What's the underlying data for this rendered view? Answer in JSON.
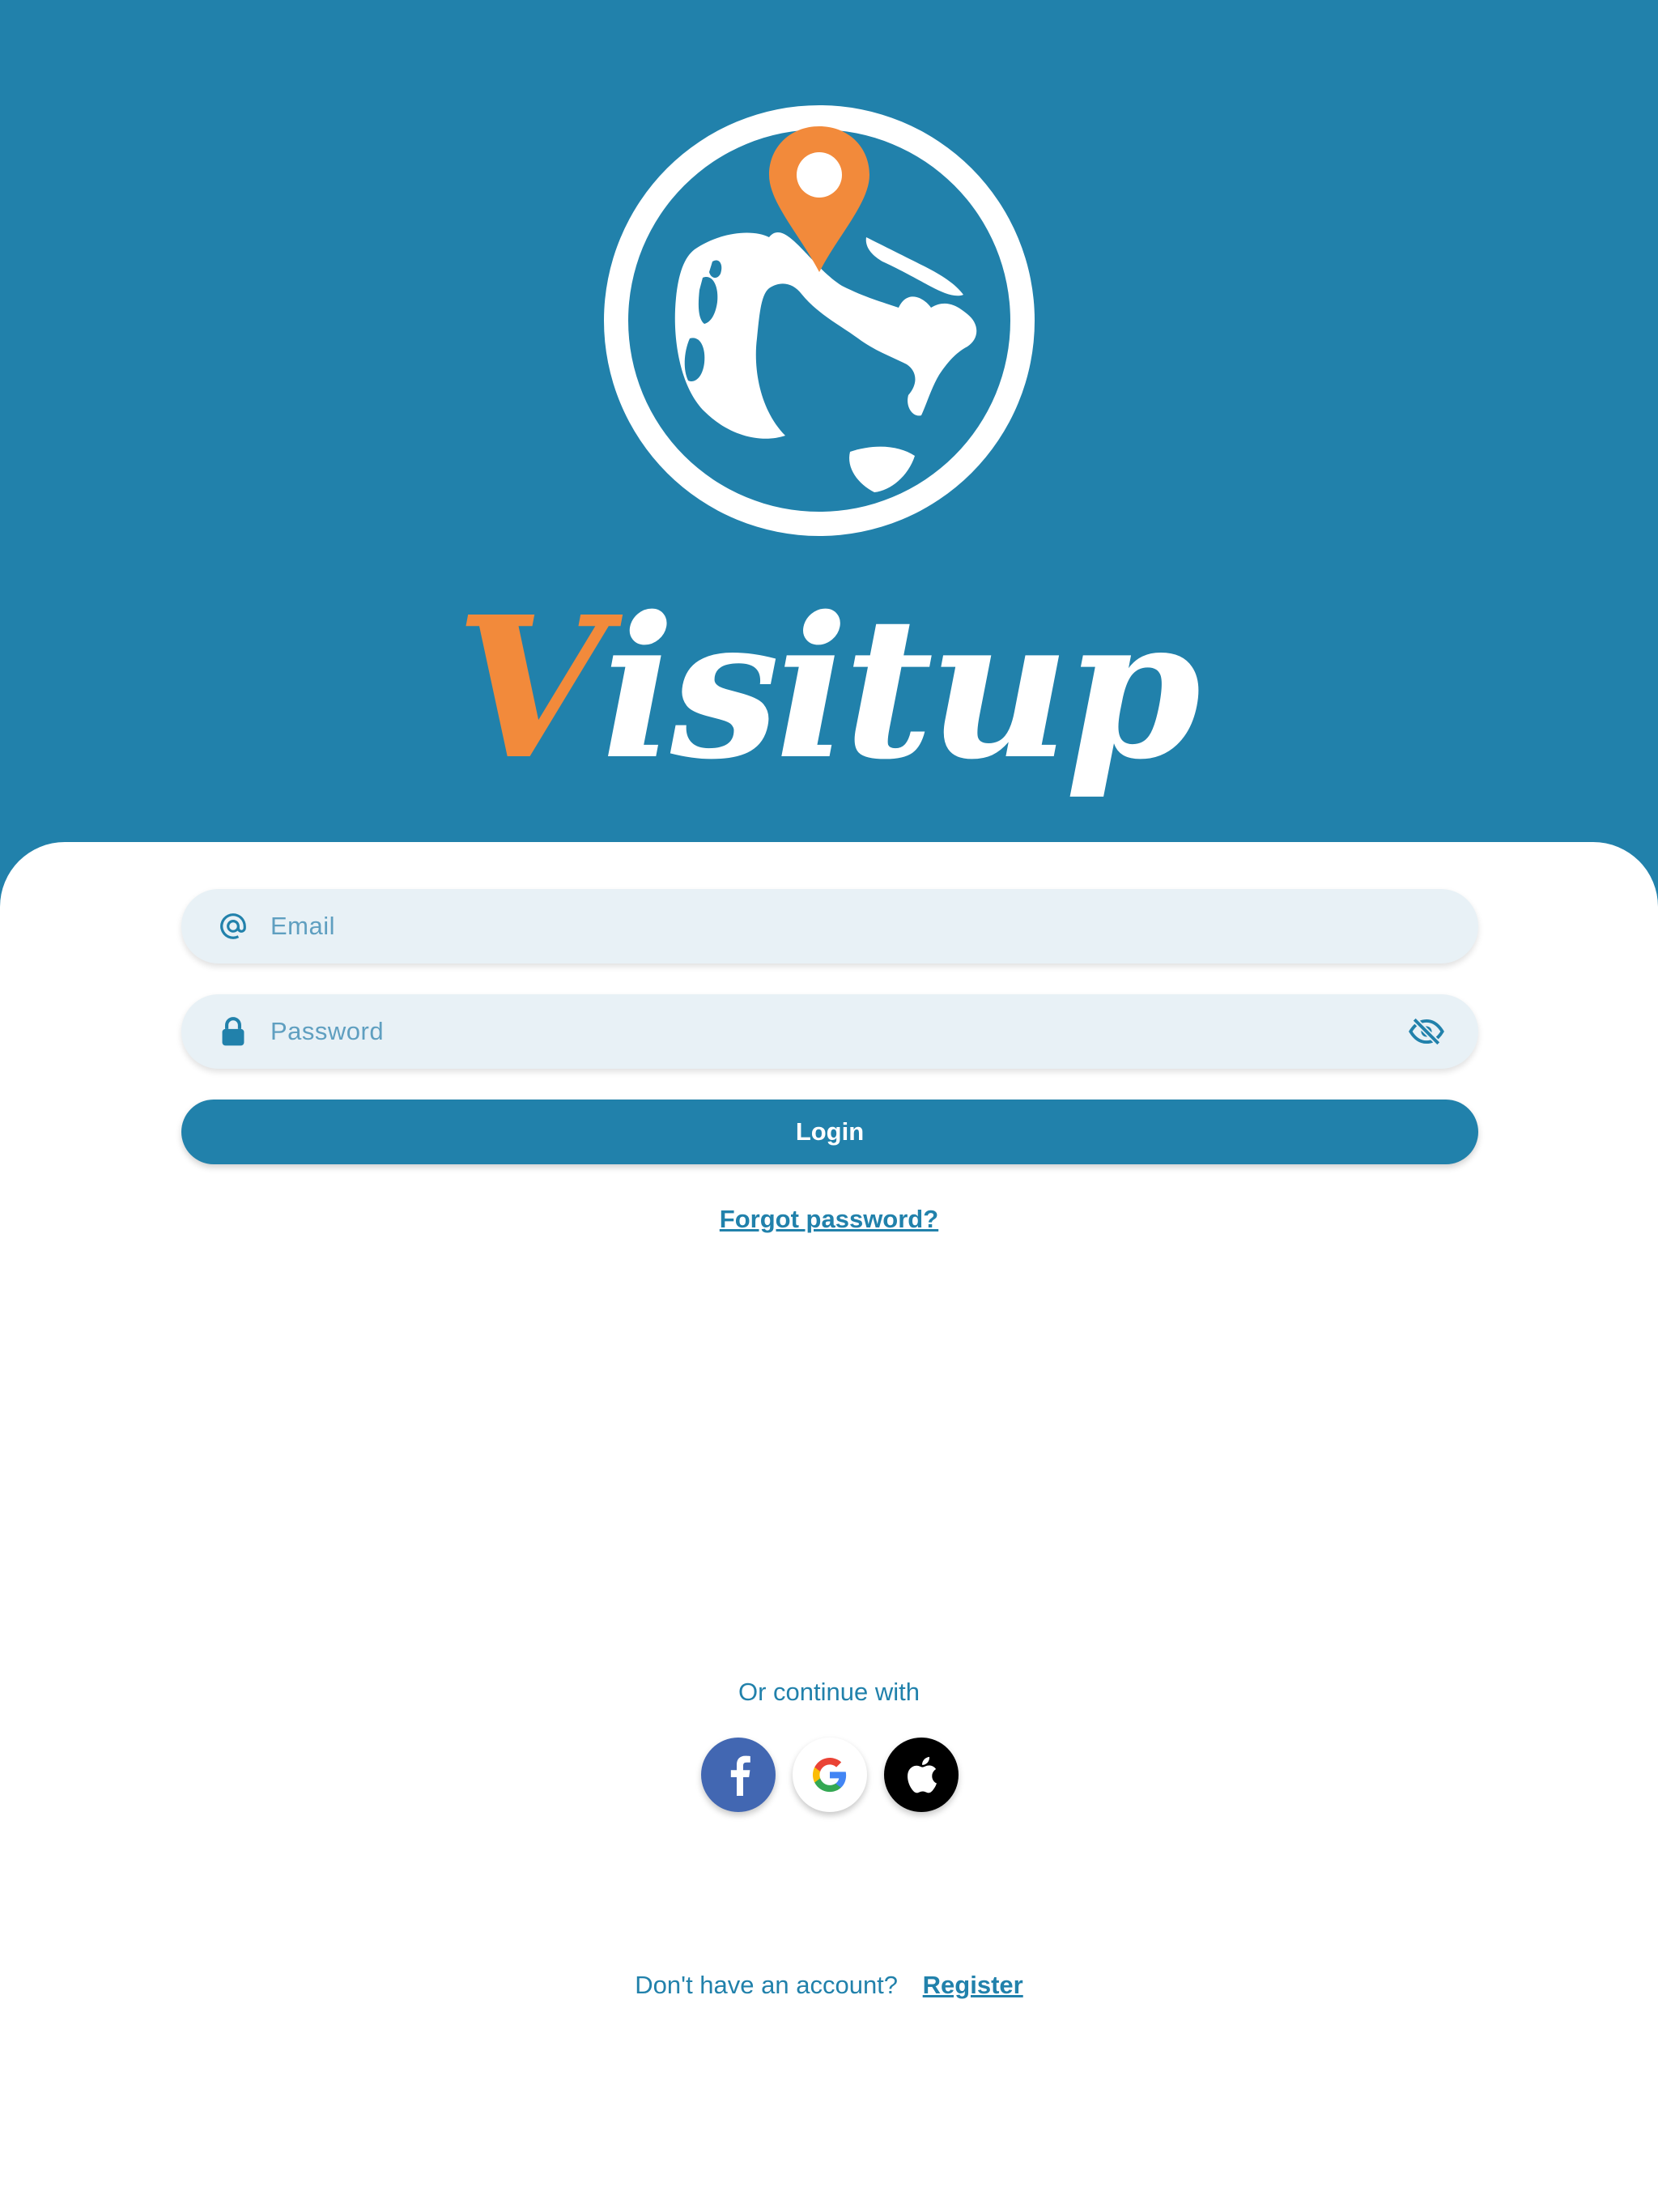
{
  "brand": {
    "name_first": "V",
    "name_rest": "isitup",
    "primary_color": "#2181ab",
    "accent_color": "#f28a3b",
    "logo_icon": "globe-with-location-pin-icon"
  },
  "form": {
    "email": {
      "placeholder": "Email",
      "icon": "at-sign-icon"
    },
    "password": {
      "placeholder": "Password",
      "icon": "lock-icon",
      "toggle_icon": "eye-off-icon"
    },
    "login_label": "Login",
    "forgot_label": "Forgot password?"
  },
  "social": {
    "heading": "Or continue with",
    "providers": [
      {
        "name": "facebook",
        "icon": "facebook-icon",
        "color": "#4267b2"
      },
      {
        "name": "google",
        "icon": "google-icon",
        "color": "#ffffff"
      },
      {
        "name": "apple",
        "icon": "apple-icon",
        "color": "#000000"
      }
    ]
  },
  "footer": {
    "prompt": "Don't have an account?",
    "register_label": "Register"
  }
}
